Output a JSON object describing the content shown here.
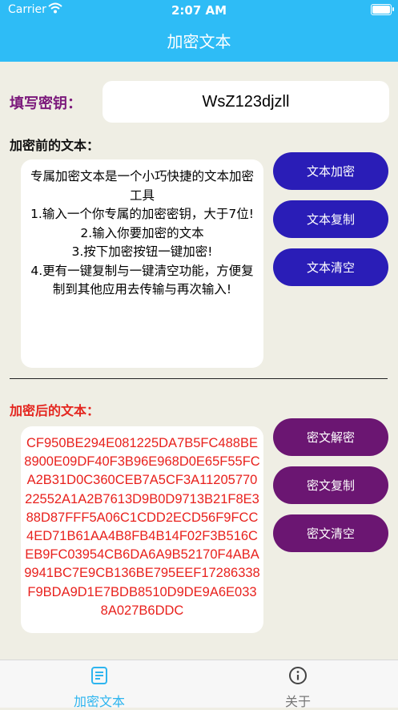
{
  "status": {
    "carrier": "Carrier",
    "time": "2:07 AM"
  },
  "header": {
    "title": "加密文本"
  },
  "key": {
    "label": "填写密钥：",
    "value": "WsZ123djzll"
  },
  "plain": {
    "label": "加密前的文本：",
    "lines": [
      "专属加密文本是一个小巧快捷的文本加密工具",
      "1.输入一个你专属的加密密钥，大于7位!",
      "2.输入你要加密的文本",
      "3.按下加密按钮一键加密!",
      "4.更有一键复制与一键清空功能，方便复制到其他应用去传输与再次输入!"
    ]
  },
  "cipher": {
    "label": "加密后的文本：",
    "text": "CF950BE294E081225DA7B5FC488BE8900E09DF40F3B96E968D0E65F55FCA2B31D0C360CEB7A5CF3A1120577022552A1A2B7613D9B0D9713B21F8E388D87FFF5A06C1CDD2ECD56F9FCC4ED71B61AA4B8FB4B14F02F3B516CEB9FC03954CB6DA6A9B52170F4ABA9941BC7E9CB136BE795EEF17286338F9BDA9D1E7BDB8510D9DE9A6E0338A027B6DDC"
  },
  "buttons": {
    "encrypt": "文本加密",
    "copy_text": "文本复制",
    "clear_text": "文本清空",
    "decrypt": "密文解密",
    "copy_cipher": "密文复制",
    "clear_cipher": "密文清空"
  },
  "tabs": [
    {
      "label": "加密文本",
      "icon": "document-icon",
      "active": true
    },
    {
      "label": "关于",
      "icon": "info-icon",
      "active": false
    }
  ],
  "colors": {
    "header": "#2ebcf6",
    "background": "#efeee4",
    "primary_button": "#2a1db7",
    "secondary_button": "#6b1672",
    "cipher_text": "#e8211d",
    "key_label": "#7b197b"
  }
}
